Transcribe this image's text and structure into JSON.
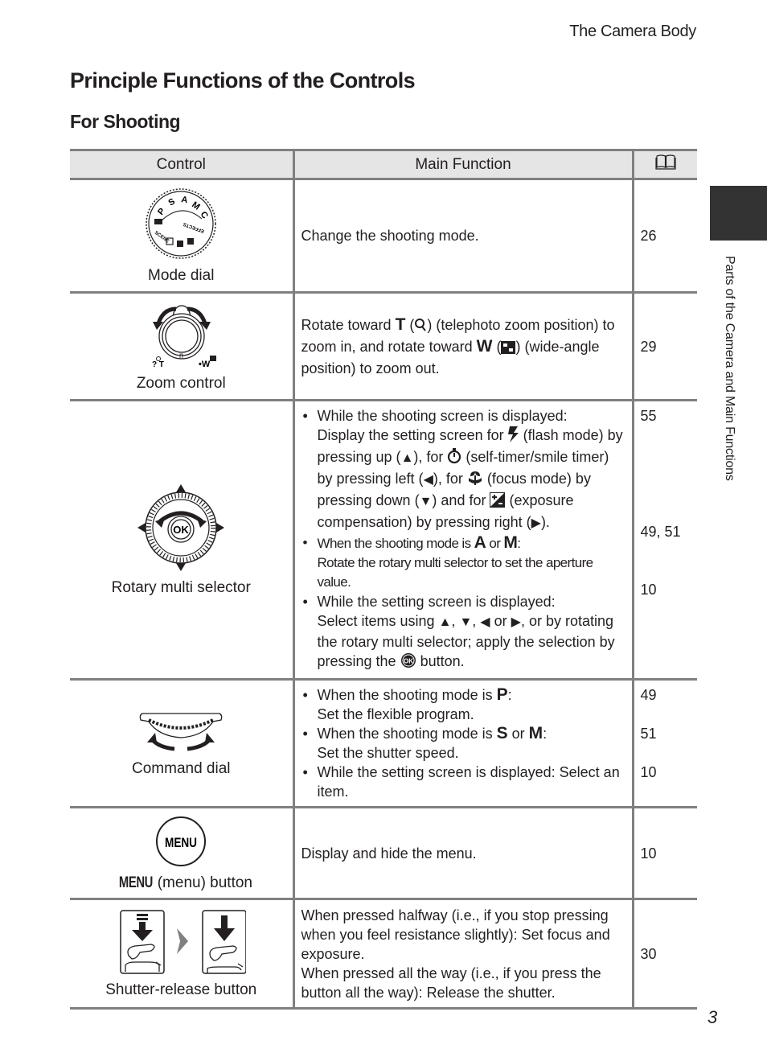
{
  "header": {
    "running_title": "The Camera Body",
    "page_title": "Principle Functions of the Controls",
    "section_title": "For Shooting",
    "side_label": "Parts of the Camera and Main Functions",
    "page_number": "3"
  },
  "table": {
    "columns": {
      "control": "Control",
      "function": "Main Function",
      "page_icon": "book-icon"
    },
    "rows": [
      {
        "control": "Mode dial",
        "icon": "mode-dial-icon",
        "dial_marks": [
          "P",
          "S",
          "A",
          "M",
          "C",
          "SCENE",
          "EFFECTS"
        ],
        "function": "Change the shooting mode.",
        "pages": "26"
      },
      {
        "control": "Zoom control",
        "icon": "zoom-control-icon",
        "function": {
          "t1": "Rotate toward ",
          "T": "T",
          "t2": " (",
          "t3": ") (telephoto zoom position) to zoom in, and rotate toward ",
          "W": "W",
          "t4": " (",
          "t5": ") (wide-angle position) to zoom out."
        },
        "pages": "29"
      },
      {
        "control": "Rotary multi selector",
        "icon": "rotary-multi-selector-icon",
        "ok_label": "OK",
        "bullets": [
          {
            "head": "While the shooting screen is displayed:",
            "a": "Display the setting screen for ",
            "b": " (flash mode) by pressing up (",
            "c": "), for ",
            "d": " (self-timer/smile timer) by pressing left (",
            "e": "), for ",
            "f": " (focus mode) by pressing down (",
            "g": ") and for ",
            "h": " (exposure compensation) by pressing right (",
            "i": ")."
          },
          {
            "head_a": "When the shooting mode is ",
            "A": "A",
            "or": " or ",
            "M": "M",
            "colon": ":",
            "body": "Rotate the rotary multi selector to set the aperture value."
          },
          {
            "head": "While the setting screen is displayed:",
            "a": "Select  items using ",
            "sep1": ", ",
            "sep2": ", ",
            "or": " or ",
            "b": ", or by rotating the rotary multi selector; apply the selection by pressing the ",
            "c": " button."
          }
        ],
        "pages": [
          "55",
          "49, 51",
          "10"
        ]
      },
      {
        "control": "Command dial",
        "icon": "command-dial-icon",
        "bullets": [
          {
            "head": "When the shooting mode is ",
            "mode": "P",
            "colon": ":",
            "body": "Set the flexible program."
          },
          {
            "head": "When the shooting mode is ",
            "mode": "S",
            "or": " or ",
            "mode2": "M",
            "colon": ":",
            "body": "Set the shutter speed."
          },
          {
            "text": "While the setting screen is displayed: Select an item."
          }
        ],
        "pages": [
          "49",
          "51",
          "10"
        ]
      },
      {
        "control_prefix": "MENU",
        "control": " (menu) button",
        "icon": "menu-button-icon",
        "button_text": "MENU",
        "function": "Display and hide the menu.",
        "pages": "10"
      },
      {
        "control": "Shutter-release button",
        "icon": "shutter-release-icon",
        "function": [
          "When pressed halfway (i.e., if you stop pressing when you feel resistance slightly): Set focus and exposure.",
          "When pressed all the way (i.e., if you press the button all the way): Release the shutter."
        ],
        "pages": "30"
      }
    ]
  }
}
